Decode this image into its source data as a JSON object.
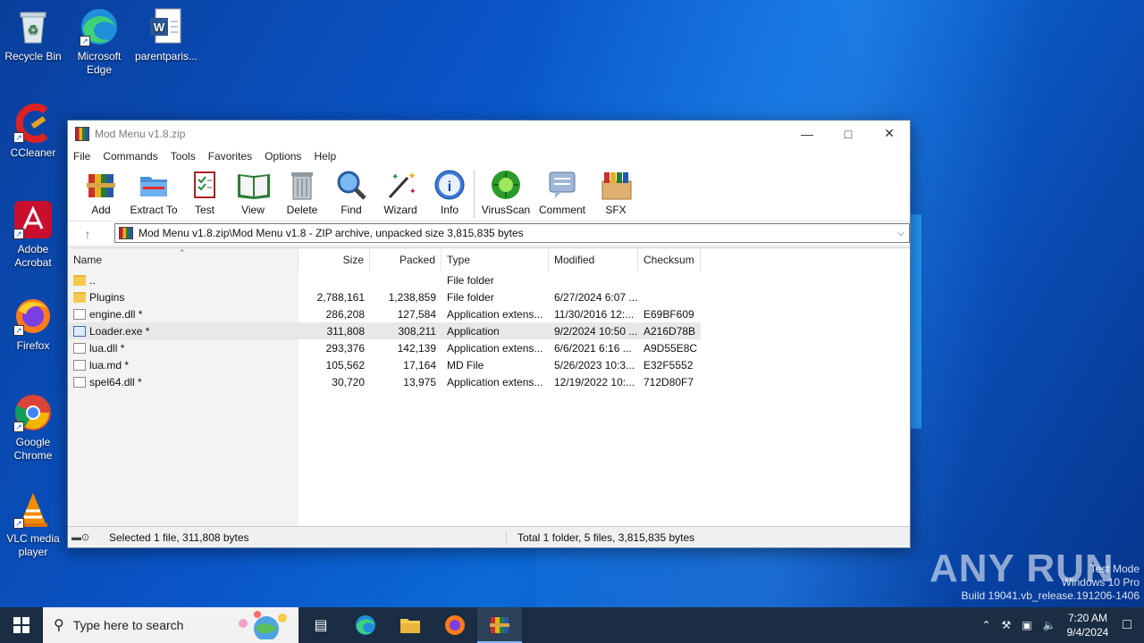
{
  "desktop": {
    "icons": [
      {
        "label": "Recycle Bin"
      },
      {
        "label": "Microsoft Edge"
      },
      {
        "label": "parentparis..."
      },
      {
        "label": "CCleaner"
      },
      {
        "label": "Adobe Acrobat"
      },
      {
        "label": "Firefox"
      },
      {
        "label": "Google Chrome"
      },
      {
        "label": "VLC media player"
      }
    ]
  },
  "window": {
    "title": "Mod Menu v1.8.zip",
    "menu": [
      "File",
      "Commands",
      "Tools",
      "Favorites",
      "Options",
      "Help"
    ],
    "toolbar": [
      "Add",
      "Extract To",
      "Test",
      "View",
      "Delete",
      "Find",
      "Wizard",
      "Info",
      "VirusScan",
      "Comment",
      "SFX"
    ],
    "address": "Mod Menu v1.8.zip\\Mod Menu v1.8 - ZIP archive, unpacked size 3,815,835 bytes",
    "columns": [
      "Name",
      "Size",
      "Packed",
      "Type",
      "Modified",
      "Checksum"
    ],
    "files": [
      {
        "name": "..",
        "size": "",
        "packed": "",
        "type": "File folder",
        "modified": "",
        "crc": "",
        "kind": "folder"
      },
      {
        "name": "Plugins",
        "size": "2,788,161",
        "packed": "1,238,859",
        "type": "File folder",
        "modified": "6/27/2024 6:07 ...",
        "crc": "",
        "kind": "folder"
      },
      {
        "name": "engine.dll *",
        "size": "286,208",
        "packed": "127,584",
        "type": "Application extens...",
        "modified": "11/30/2016 12:...",
        "crc": "E69BF609",
        "kind": "file"
      },
      {
        "name": "Loader.exe *",
        "size": "311,808",
        "packed": "308,211",
        "type": "Application",
        "modified": "9/2/2024 10:50 ...",
        "crc": "A216D78B",
        "kind": "exe"
      },
      {
        "name": "lua.dll *",
        "size": "293,376",
        "packed": "142,139",
        "type": "Application extens...",
        "modified": "6/6/2021 6:16 ...",
        "crc": "A9D55E8C",
        "kind": "file"
      },
      {
        "name": "lua.md *",
        "size": "105,562",
        "packed": "17,164",
        "type": "MD File",
        "modified": "5/26/2023 10:3...",
        "crc": "E32F5552",
        "kind": "file"
      },
      {
        "name": "spel64.dll *",
        "size": "30,720",
        "packed": "13,975",
        "type": "Application extens...",
        "modified": "12/19/2022 10:...",
        "crc": "712D80F7",
        "kind": "file"
      }
    ],
    "status_left": "Selected 1 file, 311,808 bytes",
    "status_right": "Total 1 folder, 5 files, 3,815,835 bytes"
  },
  "taskbar": {
    "search_placeholder": "Type here to search",
    "time": "7:20 AM",
    "date": "9/4/2024"
  },
  "watermark": {
    "brand": "ANY RUN",
    "line1": "Test Mode",
    "line2": "Windows 10 Pro",
    "line3": "Build 19041.vb_release.191206-1406"
  },
  "colors": {
    "accent": "#0a55c8",
    "taskbar": "#1b2d42",
    "selected_row": "#e8e8e8"
  }
}
